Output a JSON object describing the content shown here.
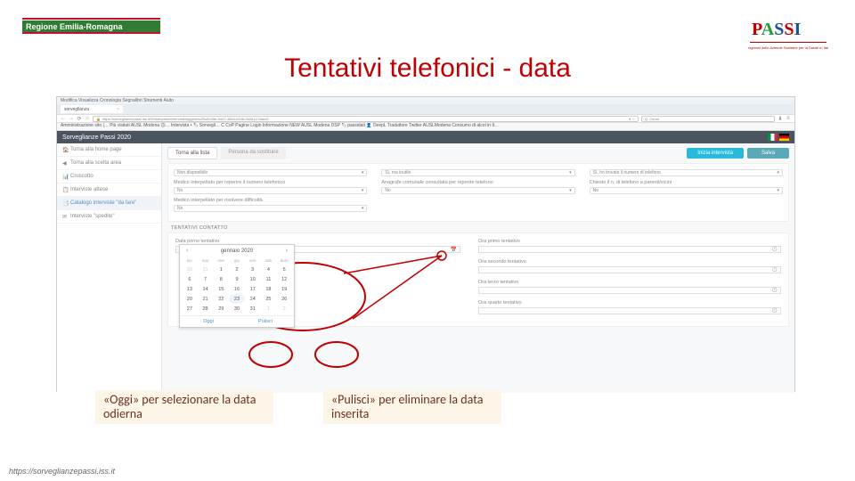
{
  "logo_region_text": "Regione Emilia-Romagna",
  "logo_passi_text": "PASSI",
  "logo_passi_sub": "Progressi delle Aziende Sanitarie per la Salute in Italia",
  "title": "Tentativi telefonici - data",
  "browser": {
    "menu": "Modifica Visualizza Cronologia Segnalibri Strumenti Aiuto",
    "tab": "sorveglianza",
    "url": "https://sorveglianzepassi.iss.it/W/dati/passi/interviste/aggiorna/20c5045e-5447-480d-b2d6-06081122aed2",
    "search_placeholder": "Cerca",
    "bookmarks": "Amministrazione sito |…  Più visitati  AUSL Modena 🛈…  Intervista • 🏷 Sorvegli…  C CoP  Pagine  Login Informazione  NEW AUSL Modena  DSP  🏷 passidati  👤 DeepL Traduttore  Twitter AUSLModena  Consumo di alcol in It…"
  },
  "app_header": "Sorveglianze  Passi 2020",
  "sidebar": {
    "items": [
      {
        "icon": "🏠",
        "label": "Torna alla home page"
      },
      {
        "icon": "◀",
        "label": "Torna alla scelta area"
      },
      {
        "icon": "📊",
        "label": "Cruscotto"
      },
      {
        "icon": "📋",
        "label": "Interviste attese"
      },
      {
        "icon": "📑",
        "label": "Catalogo interviste \"da fare\""
      },
      {
        "icon": "✉",
        "label": "Interviste \"spedite\""
      }
    ]
  },
  "tabs": {
    "t1": "Torna alla lista",
    "t2": "Persona da sostituire"
  },
  "actions": {
    "inizia": "Inizia intervista",
    "salva": "Salva"
  },
  "form": {
    "r1c1": "Non disponibile",
    "r1c2": "Sì, ma inutile",
    "r1c3": "Sì, ho trovato il numero di telefono",
    "r2c1_lbl": "Medico interpellato per reperire il numero telefonico",
    "r2c1_val": "No",
    "r2c2_lbl": "Anagrafe comunale consultata per reperire telefono",
    "r2c2_val": "No",
    "r2c3_lbl": "Chiesto il n. di telefono a parenti/vicini",
    "r2c3_val": "No",
    "r3c1_lbl": "Medico interpellato per risolvere difficoltà",
    "r3c1_val": "No"
  },
  "tentativi": {
    "header": "TENTATIVI CONTATTO",
    "data_label": "Data primo tentativo",
    "ora_labels": [
      "Ora primo tentativo",
      "Ora secondo tentativo",
      "Ora terzo tentativo",
      "Ora quarto tentativo"
    ]
  },
  "calendar": {
    "month": "gennaio 2020",
    "day_headers": [
      "lun",
      "mar",
      "mer",
      "gio",
      "ven",
      "sab",
      "dom"
    ],
    "days": [
      {
        "n": "30",
        "m": true
      },
      {
        "n": "31",
        "m": true
      },
      {
        "n": "1"
      },
      {
        "n": "2"
      },
      {
        "n": "3"
      },
      {
        "n": "4"
      },
      {
        "n": "5"
      },
      {
        "n": "6"
      },
      {
        "n": "7"
      },
      {
        "n": "8"
      },
      {
        "n": "9"
      },
      {
        "n": "10"
      },
      {
        "n": "11"
      },
      {
        "n": "12"
      },
      {
        "n": "13"
      },
      {
        "n": "14"
      },
      {
        "n": "15"
      },
      {
        "n": "16"
      },
      {
        "n": "17"
      },
      {
        "n": "18"
      },
      {
        "n": "19"
      },
      {
        "n": "20"
      },
      {
        "n": "21"
      },
      {
        "n": "22"
      },
      {
        "n": "23",
        "sel": true
      },
      {
        "n": "24"
      },
      {
        "n": "25"
      },
      {
        "n": "26"
      },
      {
        "n": "27"
      },
      {
        "n": "28"
      },
      {
        "n": "29"
      },
      {
        "n": "30"
      },
      {
        "n": "31"
      },
      {
        "n": "1",
        "m": true
      },
      {
        "n": "2",
        "m": true
      }
    ],
    "oggi": "Oggi",
    "pulisci": "Pulisci"
  },
  "captions": {
    "oggi": "«Oggi» per selezionare la data odierna",
    "pulisci": "«Pulisci» per eliminare la data inserita"
  },
  "footer": "https://sorveglianzepassi.iss.it"
}
